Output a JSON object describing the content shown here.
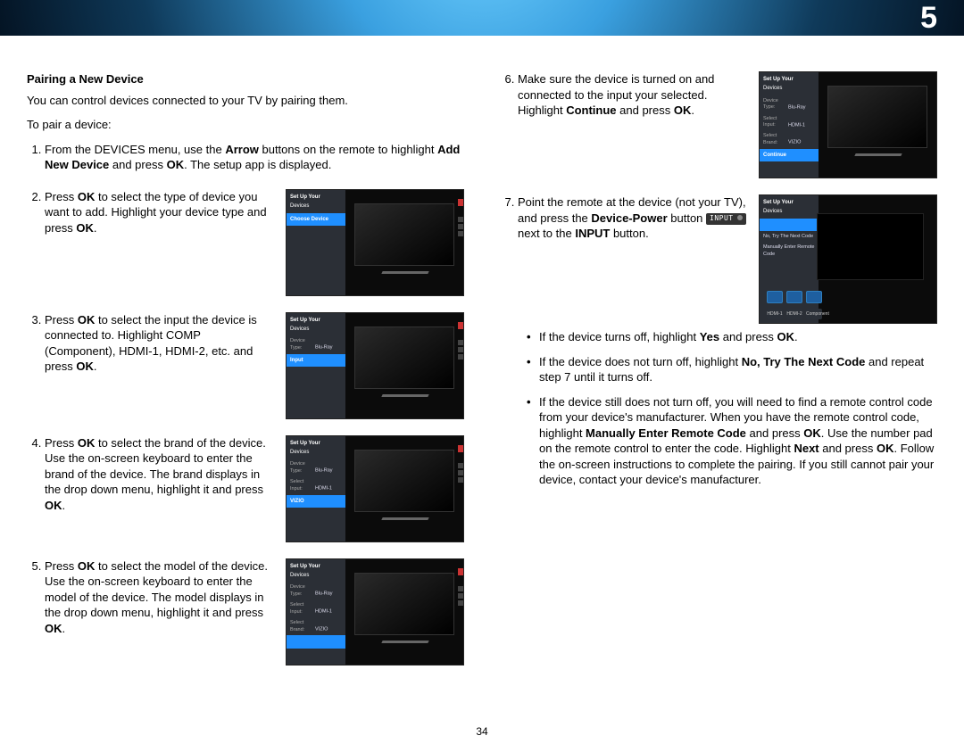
{
  "chapter_number": "5",
  "page_number": "34",
  "section_title": "Pairing a New Device",
  "intro1": "You can control devices connected to your TV by pairing them.",
  "intro2": "To pair a device:",
  "step1": {
    "pre": "From the DEVICES menu, use the ",
    "b1": "Arrow",
    "mid1": " buttons on the remote to highlight ",
    "b2": "Add New Device",
    "mid2": " and press ",
    "b3": "OK",
    "post": ". The setup app is displayed."
  },
  "step2": {
    "pre": "Press ",
    "b1": "OK",
    "mid": " to select the type of device you want to add. Highlight your device type and press ",
    "b2": "OK",
    "post": "."
  },
  "step3": {
    "pre": "Press ",
    "b1": "OK",
    "mid": " to select the input the device is connected to. Highlight COMP (Component), HDMI-1, HDMI-2, etc. and press ",
    "b2": "OK",
    "post": "."
  },
  "step4": {
    "pre": "Press ",
    "b1": "OK",
    "mid": " to select the brand of the device. Use the on-screen keyboard to enter the brand of the device. The brand displays in the drop down menu, highlight it and press ",
    "b2": "OK",
    "post": "."
  },
  "step5": {
    "pre": "Press ",
    "b1": "OK",
    "mid": " to select the model of the device. Use the on-screen keyboard to enter the model of the  device. The model displays in the drop down menu, highlight it and press ",
    "b2": "OK",
    "post": "."
  },
  "step6": {
    "pre": "Make sure the device is turned on and connected to the input your selected. Highlight ",
    "b1": "Continue",
    "mid": " and press ",
    "b2": "OK",
    "post": "."
  },
  "step7": {
    "pre": "Point the remote at the device (not your TV), and press the ",
    "b1": "Device-Power",
    "mid": " button ",
    "chip": "INPUT",
    "mid2": " next to the ",
    "b2": "INPUT",
    "post": " button.",
    "bA": {
      "pre": "If the device turns off, highlight ",
      "b1": "Yes",
      "mid": " and press ",
      "b2": "OK",
      "post": "."
    },
    "bB": {
      "pre": "If the device does not turn off, highlight ",
      "b1": "No, Try The Next Code",
      "post": " and repeat step 7 until it turns off."
    },
    "bC": {
      "pre": "If the device still does not turn off, you will need to find a remote control code from your device's manufacturer. When you have the remote control code, highlight ",
      "b1": "Manually Enter Remote Code",
      "mid": " and press ",
      "b2": "OK",
      "mid2": ". Use the number pad on the remote control to enter the code. Highlight ",
      "b3": "Next",
      "mid3": " and press ",
      "b4": "OK",
      "post": ". Follow the on-screen instructions to complete the pairing. If you still cannot pair your device, contact your device's manufacturer."
    }
  },
  "ui": {
    "panel_title": "Set Up Your",
    "panel_sub": "Devices",
    "row_device": "Device Type:",
    "val_bluray": "Blu-Ray",
    "row_input": "Select Input:",
    "val_hdmi": "HDMI-1",
    "row_brand": "Select Brand:",
    "val_vizio": "VIZIO",
    "confirm": "Continue",
    "choose": "Choose Device",
    "input": "Input",
    "retry": "No, Try The Next Code",
    "manual": "Manually Enter Remote Code",
    "hdmi1": "HDMI-1",
    "hdmi2": "HDMI-2",
    "comp": "Component"
  }
}
